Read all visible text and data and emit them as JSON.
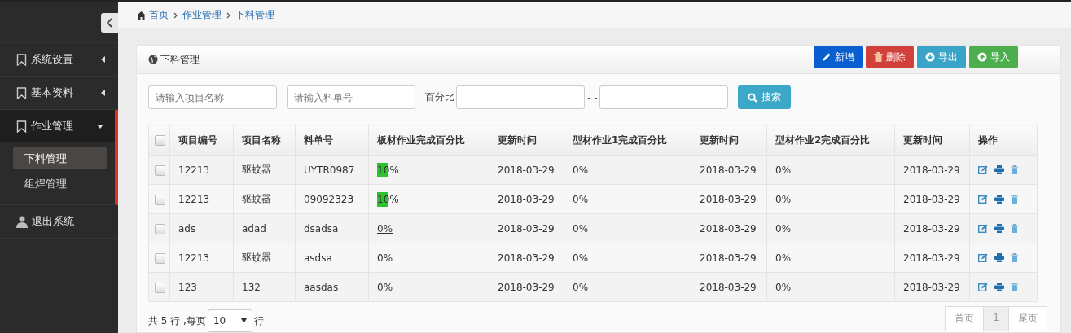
{
  "sidebar": {
    "items": [
      {
        "kind": "group",
        "label": "系统设置",
        "expanded": false
      },
      {
        "kind": "group",
        "label": "基本资料",
        "expanded": false
      },
      {
        "kind": "group",
        "label": "作业管理",
        "expanded": true,
        "children": [
          {
            "label": "下料管理",
            "selected": true
          },
          {
            "label": "组焊管理",
            "selected": false
          }
        ]
      },
      {
        "kind": "logout",
        "label": "退出系统"
      }
    ]
  },
  "breadcrumb": [
    "首页",
    "作业管理",
    "下料管理"
  ],
  "panel": {
    "title": "下料管理",
    "actions": [
      {
        "kind": "add",
        "label": "新增",
        "color": "#0a5fd0"
      },
      {
        "kind": "delete",
        "label": "删除",
        "color": "#d2403c"
      },
      {
        "kind": "export",
        "label": "导出",
        "color": "#3aa4c8"
      },
      {
        "kind": "import",
        "label": "导入",
        "color": "#4cae4c"
      }
    ],
    "filters": {
      "project_name": {
        "placeholder": "请输入项目名称"
      },
      "order_no": {
        "placeholder": "请输入料单号"
      },
      "percent_label": "百分比",
      "range_separator": "- -",
      "search_button": "搜索"
    },
    "table": {
      "select_all_checked": false,
      "columns": [
        "项目编号",
        "项目名称",
        "料单号",
        "板材作业完成百分比",
        "更新时间",
        "型材作业1完成百分比",
        "更新时间",
        "型材作业2完成百分比",
        "更新时间",
        "操作"
      ],
      "rows": [
        {
          "checked": false,
          "id": "12213",
          "name": "驱蚊器",
          "order": "UYTR0987",
          "plate": {
            "text": "10%",
            "level": 0.1,
            "link": false
          },
          "t1": "2018-03-29",
          "p1": "0%",
          "t2": "2018-03-29",
          "p2": "0%",
          "t3": "2018-03-29"
        },
        {
          "checked": false,
          "id": "12213",
          "name": "驱蚊器",
          "order": "09092323",
          "plate": {
            "text": "10%",
            "level": 0.1,
            "link": false
          },
          "t1": "2018-03-29",
          "p1": "0%",
          "t2": "2018-03-29",
          "p2": "0%",
          "t3": "2018-03-29"
        },
        {
          "checked": false,
          "id": "ads",
          "name": "adad",
          "order": "dsadsa",
          "plate": {
            "text": "0%",
            "level": 0,
            "link": true
          },
          "t1": "2018-03-29",
          "p1": "0%",
          "t2": "2018-03-29",
          "p2": "0%",
          "t3": "2018-03-29"
        },
        {
          "checked": false,
          "id": "12213",
          "name": "驱蚊器",
          "order": "asdsa",
          "plate": {
            "text": "0%",
            "level": 0,
            "link": false
          },
          "t1": "2018-03-29",
          "p1": "0%",
          "t2": "2018-03-29",
          "p2": "0%",
          "t3": "2018-03-29"
        },
        {
          "checked": false,
          "id": "123",
          "name": "132",
          "order": "aasdas",
          "plate": {
            "text": "0%",
            "level": 0,
            "link": false
          },
          "t1": "2018-03-29",
          "p1": "0%",
          "t2": "2018-03-29",
          "p2": "0%",
          "t3": "2018-03-29"
        }
      ]
    },
    "footer": {
      "total_prefix": "共 5 行 ,每页",
      "page_size": "10",
      "total_suffix": "行",
      "pager": [
        {
          "label": "首页",
          "selected": false
        },
        {
          "label": "1",
          "selected": true
        },
        {
          "label": "尾页",
          "selected": false
        }
      ]
    }
  }
}
